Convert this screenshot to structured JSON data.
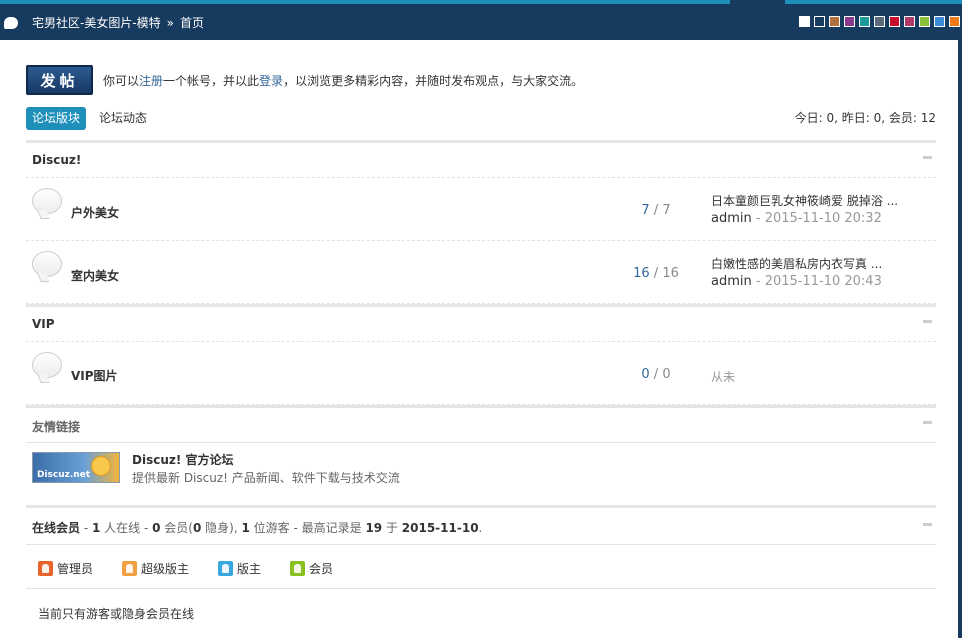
{
  "header": {
    "breadcrumb": [
      "宅男社区-美女图片-模特",
      "»",
      "首页"
    ],
    "swatch_colors": [
      "#ffffff",
      "#173a5f",
      "#b07040",
      "#8a3a8a",
      "#1d9a9a",
      "#5a6a7a",
      "#c8102e",
      "#b03a6a",
      "#8ac03a",
      "#3a8ad8",
      "#f07a1a"
    ]
  },
  "post": {
    "button_label": "发帖",
    "notice_prefix": "你可以",
    "register_link": "注册",
    "notice_mid": "一个帐号，并以此",
    "login_link": "登录",
    "notice_suffix": "，以浏览更多精彩内容，并随时发布观点，与大家交流。"
  },
  "tabs": {
    "active": "论坛版块",
    "other": "论坛动态",
    "stats": "今日: 0, 昨日: 0, 会员: 12"
  },
  "categories": [
    {
      "title": "Discuz!",
      "forums": [
        {
          "name": "户外美女",
          "threads": "7",
          "sep": "/",
          "posts": "7",
          "last_title": "日本童颜巨乳女神筱崎爱 脱掉浴 ...",
          "last_author": "admin",
          "last_time": "- 2015-11-10 20:32"
        },
        {
          "name": "室内美女",
          "threads": "16",
          "sep": "/",
          "posts": "16",
          "last_title": "白嫩性感的美眉私房内衣写真 ...",
          "last_author": "admin",
          "last_time": "- 2015-11-10 20:43"
        }
      ]
    },
    {
      "title": "VIP",
      "forums": [
        {
          "name": "VIP图片",
          "threads": "0",
          "sep": "/",
          "posts": "0",
          "never": "从未"
        }
      ]
    }
  ],
  "links": {
    "title": "友情链接",
    "logo_text": "Discuz.net",
    "site_name": "Discuz! 官方论坛",
    "site_desc": "提供最新 Discuz! 产品新闻、软件下载与技术交流"
  },
  "online": {
    "label": "在线会员",
    "parts": [
      " - ",
      "1",
      " 人在线 - ",
      "0",
      " 会员(",
      "0",
      " 隐身), ",
      "1",
      " 位游客 - 最高记录是 ",
      "19",
      " 于 ",
      "2015-11-10",
      "."
    ],
    "legend": [
      {
        "label": "管理员",
        "color": "#e8642c"
      },
      {
        "label": "超级版主",
        "color": "#f0a040"
      },
      {
        "label": "版主",
        "color": "#3aa8e0"
      },
      {
        "label": "会员",
        "color": "#8ac020"
      }
    ],
    "note": "当前只有游客或隐身会员在线"
  }
}
